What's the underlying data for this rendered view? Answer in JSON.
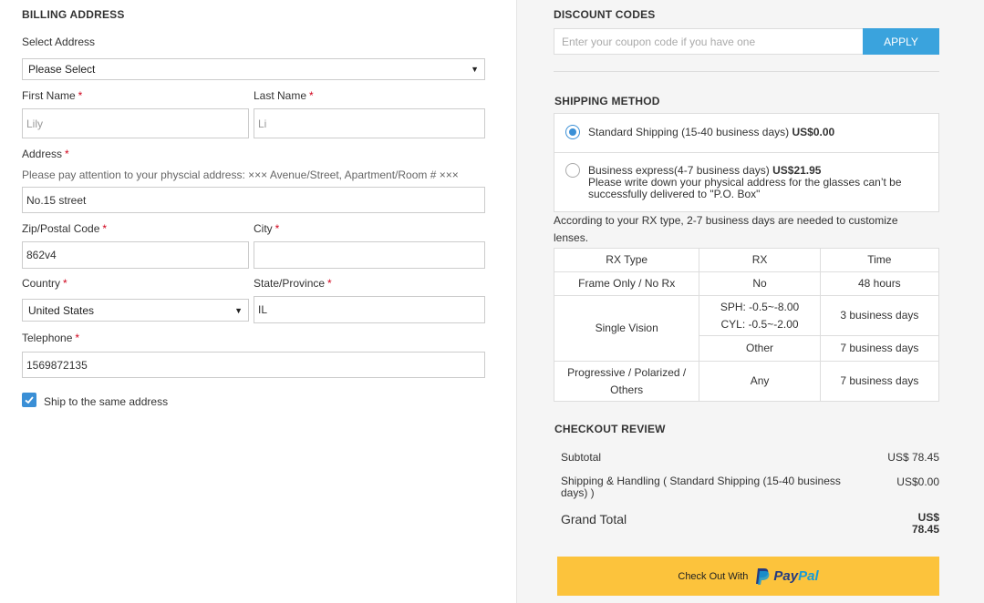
{
  "billing": {
    "title": "BILLING ADDRESS",
    "select_label": "Select Address",
    "select_value": "Please Select",
    "first_name_label": "First Name",
    "first_name_value": "Lily",
    "last_name_label": "Last Name",
    "last_name_value": "Li",
    "address_label": "Address",
    "address_note": "Please pay attention to your physcial address: ××× Avenue/Street, Apartment/Room # ×××",
    "address_value": "No.15  street",
    "zip_label": "Zip/Postal Code",
    "zip_value": "862v4",
    "city_label": "City",
    "city_value": "",
    "country_label": "Country",
    "country_value": "United States",
    "state_label": "State/Province",
    "state_value": "IL",
    "telephone_label": "Telephone",
    "telephone_value": "1569872135",
    "ship_same_label": "Ship to the same address",
    "ship_same_checked": true,
    "required_mark": "*"
  },
  "discount": {
    "title": "DISCOUNT CODES",
    "placeholder": "Enter your coupon code if you have one",
    "apply_label": "APPLY"
  },
  "shipping": {
    "title": "SHIPPING METHOD",
    "options": [
      {
        "label": "Standard Shipping (15-40 business days)",
        "price": "US$0.00",
        "selected": true,
        "note": ""
      },
      {
        "label": "Business express(4-7 business days)",
        "price": "US$21.95",
        "selected": false,
        "note": "Please write down your physical address for the glasses can’t be successfully delivered to \"P.O. Box\""
      }
    ],
    "rx_note": "According to your RX type, 2-7 business days are needed to customize lenses."
  },
  "rx_table": {
    "headers": [
      "RX Type",
      "RX",
      "Time"
    ],
    "rows": {
      "frame_only": {
        "type": "Frame Only / No Rx",
        "rx": "No",
        "time": "48 hours"
      },
      "single_vision_type": "Single Vision",
      "single_vision_rx_1": "SPH: -0.5~-8.00",
      "single_vision_rx_2": "CYL: -0.5~-2.00",
      "single_vision_time": "3 business days",
      "single_vision_other_rx": "Other",
      "single_vision_other_time": "7 business days",
      "progressive": {
        "type_1": "Progressive / Polarized /",
        "type_2": "Others",
        "rx": "Any",
        "time": "7 business days"
      }
    }
  },
  "review": {
    "title": "CHECKOUT REVIEW",
    "subtotal_label": "Subtotal",
    "subtotal_value": "US$ 78.45",
    "shipping_label": "Shipping & Handling ( Standard Shipping (15-40 business days) )",
    "shipping_value": "US$0.00",
    "grand_total_label": "Grand Total",
    "grand_total_value_1": "US$",
    "grand_total_value_2": "78.45"
  },
  "paypal": {
    "prefix": "Check Out With",
    "brand_a": "Pay",
    "brand_b": "Pal"
  },
  "colors": {
    "accent": "#3aa3dd",
    "required": "#d0021b",
    "paypal_button": "#fcc33c",
    "paypal_dark": "#253b80",
    "paypal_light": "#179bd7"
  }
}
